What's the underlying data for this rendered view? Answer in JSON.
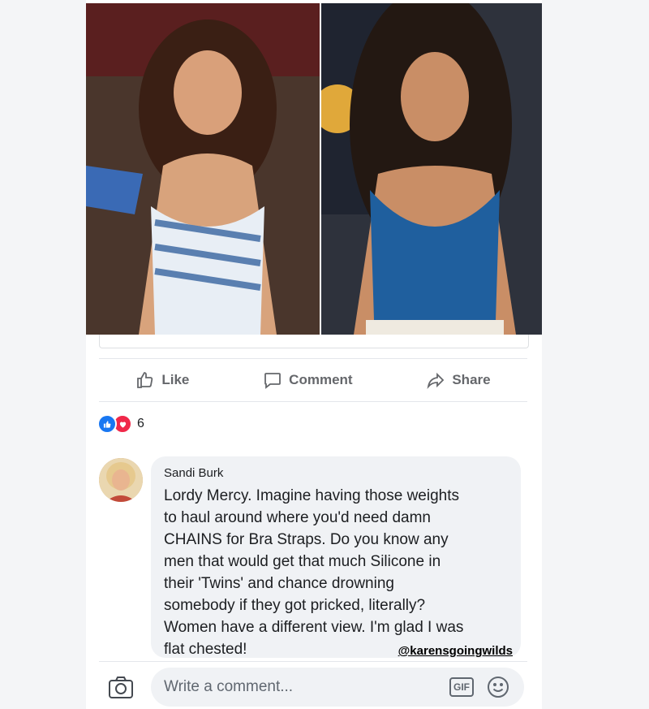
{
  "post": {
    "photos": [
      {
        "name": "left-photo",
        "alt": ""
      },
      {
        "name": "right-photo",
        "alt": ""
      }
    ]
  },
  "actions": {
    "like": "Like",
    "comment": "Comment",
    "share": "Share"
  },
  "reactions": {
    "count": "6",
    "types": [
      "like-icon",
      "love-icon"
    ],
    "colors": {
      "like": "#1877f2",
      "love": "#f02849"
    }
  },
  "comment": {
    "author": "Sandi Burk",
    "text": "Lordy Mercy. Imagine having those weights\nto haul around where you'd need damn\nCHAINS for Bra Straps. Do you know any\nmen that would get that much Silicone in\ntheir 'Twins' and chance drowning\nsomebody if they got pricked, literally?\nWomen have a different view. I'm glad I was\nflat chested!",
    "watermark": "@karensgoingwilds"
  },
  "composer": {
    "placeholder": "Write a comment...",
    "gif_label": "GIF"
  }
}
